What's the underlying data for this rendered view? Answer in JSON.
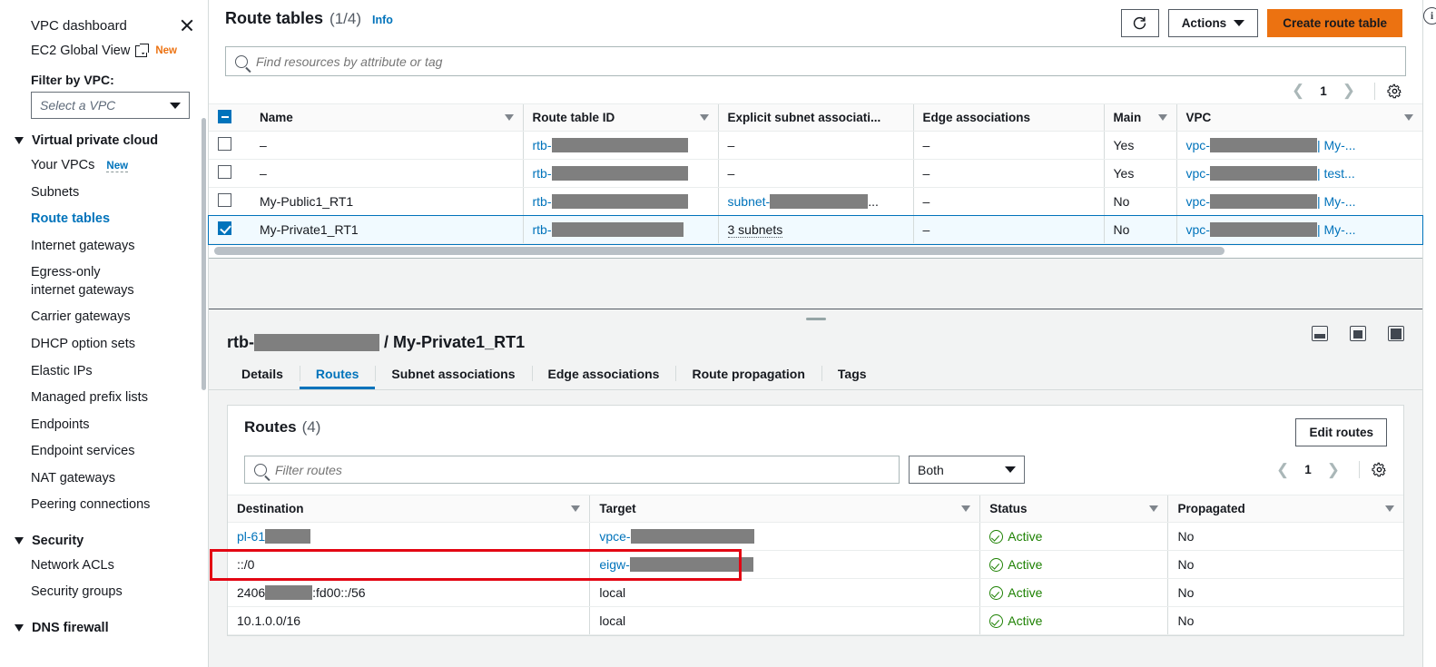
{
  "sidebar": {
    "dashboard_label": "VPC dashboard",
    "close_icon": "close-icon",
    "global_view_label": "EC2 Global View",
    "global_view_badge": "New",
    "filter_label": "Filter by VPC:",
    "vpc_select_placeholder": "Select a VPC",
    "groups": [
      {
        "title": "Virtual private cloud",
        "items": [
          {
            "label": "Your VPCs",
            "badge": "New",
            "active": false
          },
          {
            "label": "Subnets",
            "badge": "",
            "active": false
          },
          {
            "label": "Route tables",
            "badge": "",
            "active": true
          },
          {
            "label": "Internet gateways",
            "badge": "",
            "active": false
          },
          {
            "label": "Egress-only internet gateways",
            "badge": "",
            "active": false
          },
          {
            "label": "Carrier gateways",
            "badge": "",
            "active": false
          },
          {
            "label": "DHCP option sets",
            "badge": "",
            "active": false
          },
          {
            "label": "Elastic IPs",
            "badge": "",
            "active": false
          },
          {
            "label": "Managed prefix lists",
            "badge": "",
            "active": false
          },
          {
            "label": "Endpoints",
            "badge": "",
            "active": false
          },
          {
            "label": "Endpoint services",
            "badge": "",
            "active": false
          },
          {
            "label": "NAT gateways",
            "badge": "",
            "active": false
          },
          {
            "label": "Peering connections",
            "badge": "",
            "active": false
          }
        ]
      },
      {
        "title": "Security",
        "items": [
          {
            "label": "Network ACLs",
            "badge": "",
            "active": false
          },
          {
            "label": "Security groups",
            "badge": "",
            "active": false
          }
        ]
      },
      {
        "title": "DNS firewall",
        "items": []
      }
    ]
  },
  "header": {
    "title": "Route tables",
    "count": "(1/4)",
    "info_label": "Info",
    "search_placeholder": "Find resources by attribute or tag",
    "refresh_icon": "refresh-icon",
    "actions_label": "Actions",
    "create_label": "Create route table",
    "page_number": "1",
    "settings_icon": "gear-icon",
    "info_icon": "info-icon"
  },
  "route_tables": {
    "columns": [
      "Name",
      "Route table ID",
      "Explicit subnet associati...",
      "Edge associations",
      "Main",
      "VPC"
    ],
    "rows": [
      {
        "selected": false,
        "name": "–",
        "rtb_prefix": "rtb-",
        "rtb_redacted_width": 150,
        "subnet": "–",
        "subnet_is_link": false,
        "subnet_redacted_width": 0,
        "subnet_suffix": "",
        "edge": "–",
        "main": "Yes",
        "vpc_prefix": "vpc-",
        "vpc_suffix": "| My-..."
      },
      {
        "selected": false,
        "name": "–",
        "rtb_prefix": "rtb-",
        "rtb_redacted_width": 150,
        "subnet": "–",
        "subnet_is_link": false,
        "subnet_redacted_width": 0,
        "subnet_suffix": "",
        "edge": "–",
        "main": "Yes",
        "vpc_prefix": "vpc-",
        "vpc_suffix": "| test..."
      },
      {
        "selected": false,
        "name": "My-Public1_RT1",
        "rtb_prefix": "rtb-",
        "rtb_redacted_width": 150,
        "subnet": "subnet-",
        "subnet_is_link": true,
        "subnet_redacted_width": 108,
        "subnet_suffix": "...",
        "edge": "–",
        "main": "No",
        "vpc_prefix": "vpc-",
        "vpc_suffix": "| My-..."
      },
      {
        "selected": true,
        "name": "My-Private1_RT1",
        "rtb_prefix": "rtb-",
        "rtb_redacted_width": 145,
        "subnet": "3 subnets",
        "subnet_is_link": false,
        "subnet_redacted_width": 0,
        "subnet_suffix": "",
        "edge": "–",
        "main": "No",
        "vpc_prefix": "vpc-",
        "vpc_suffix": "| My-..."
      }
    ]
  },
  "detail": {
    "breadcrumb_prefix": "rtb-",
    "breadcrumb_suffix": "/ My-Private1_RT1",
    "tabs": [
      {
        "label": "Details",
        "active": false
      },
      {
        "label": "Routes",
        "active": true
      },
      {
        "label": "Subnet associations",
        "active": false
      },
      {
        "label": "Edge associations",
        "active": false
      },
      {
        "label": "Route propagation",
        "active": false
      },
      {
        "label": "Tags",
        "active": false
      }
    ],
    "panel_controls": [
      "split-panel-bottom-icon",
      "split-panel-side-icon",
      "split-panel-full-icon"
    ]
  },
  "routes_panel": {
    "title": "Routes",
    "count": "(4)",
    "filter_placeholder": "Filter routes",
    "select_value": "Both",
    "edit_label": "Edit routes",
    "page_number": "1",
    "settings_icon": "gear-icon",
    "columns": [
      "Destination",
      "Target",
      "Status",
      "Propagated"
    ],
    "rows": [
      {
        "dest_text": "pl-61",
        "dest_is_link": true,
        "dest_redacted_width": 50,
        "dest_suffix": "",
        "target_text": "vpce-",
        "target_is_link": true,
        "target_redacted_width": 136,
        "status": "Active",
        "propagated": "No",
        "highlighted": false
      },
      {
        "dest_text": "::/0",
        "dest_is_link": false,
        "dest_redacted_width": 0,
        "dest_suffix": "",
        "target_text": "eigw-",
        "target_is_link": true,
        "target_redacted_width": 136,
        "status": "Active",
        "propagated": "No",
        "highlighted": true
      },
      {
        "dest_text": "2406",
        "dest_is_link": false,
        "dest_redacted_width": 52,
        "dest_suffix": ":fd00::/56",
        "target_text": "local",
        "target_is_link": false,
        "target_redacted_width": 0,
        "status": "Active",
        "propagated": "No",
        "highlighted": false
      },
      {
        "dest_text": "10.1.0.0/16",
        "dest_is_link": false,
        "dest_redacted_width": 0,
        "dest_suffix": "",
        "target_text": "local",
        "target_is_link": false,
        "target_redacted_width": 0,
        "status": "Active",
        "propagated": "No",
        "highlighted": false
      }
    ]
  },
  "colors": {
    "accent": "#0073bb",
    "primary_button": "#ec7211",
    "status_active": "#1d8102",
    "highlight_box": "#e30613"
  }
}
